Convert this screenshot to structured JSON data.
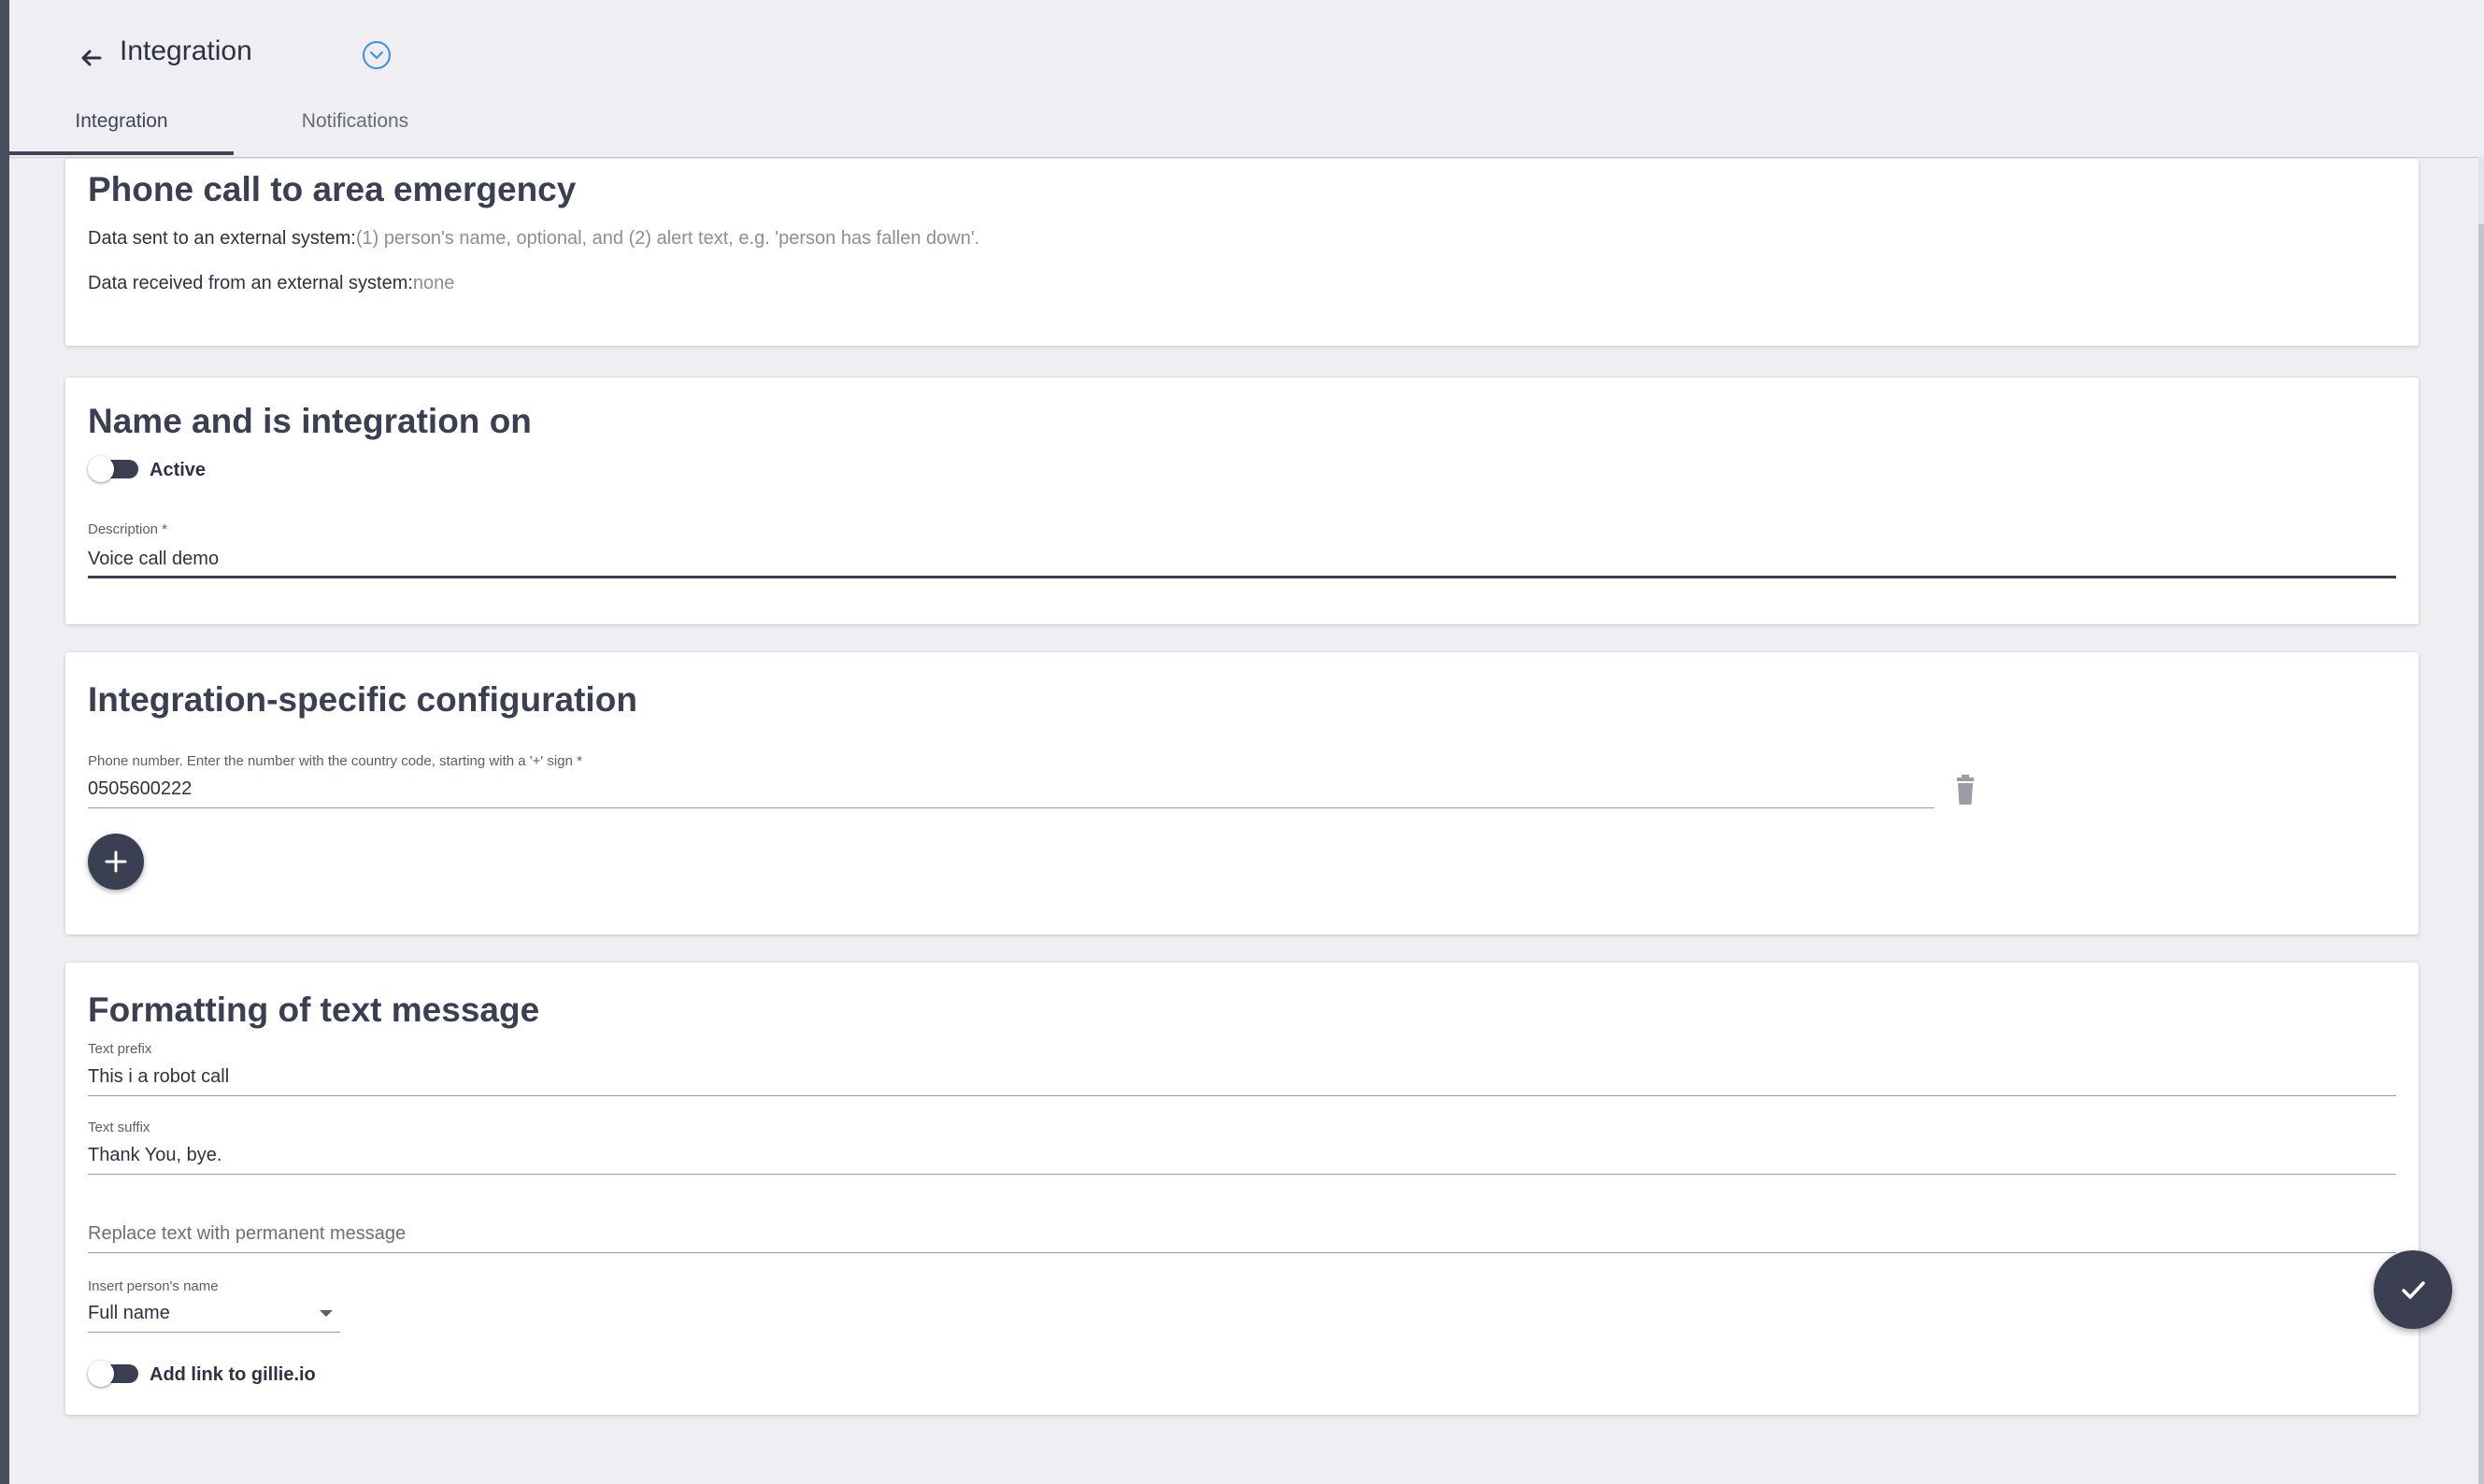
{
  "header": {
    "title": "Integration",
    "back_icon": "arrow-left-icon",
    "collapse_icon": "chevron-down-circle-icon",
    "accent_color": "#3b8ee0"
  },
  "tabs": [
    {
      "label": "Integration",
      "active": true
    },
    {
      "label": "Notifications",
      "active": false
    }
  ],
  "info_card": {
    "title": "Phone call to area emergency",
    "sent_label": "Data sent to an external system:",
    "sent_value": "(1) person's name, optional, and (2) alert text, e.g. 'person has fallen down'.",
    "received_label": "Data received from an external system:",
    "received_value": "none"
  },
  "name_card": {
    "title": "Name and is integration on",
    "active_label": "Active",
    "active_on": false,
    "description_label": "Description *",
    "description_value": "Voice call demo"
  },
  "config_card": {
    "title": "Integration-specific configuration",
    "phone_label": "Phone number. Enter the number with the country code, starting with a '+' sign *",
    "phone_value": "0505600222",
    "delete_icon": "trash-icon",
    "add_icon": "plus-icon"
  },
  "format_card": {
    "title": "Formatting of text message",
    "prefix_label": "Text prefix",
    "prefix_value": "This i a robot call",
    "suffix_label": "Text suffix",
    "suffix_value": "Thank You, bye.",
    "replace_placeholder": "Replace text with permanent message",
    "name_select_label": "Insert person's name",
    "name_select_value": "Full name",
    "link_label": "Add link to gillie.io",
    "link_on": false
  },
  "save_icon": "check-icon",
  "colors": {
    "primary_dark": "#3a3f52",
    "background": "#efeff3",
    "card": "#ffffff"
  }
}
